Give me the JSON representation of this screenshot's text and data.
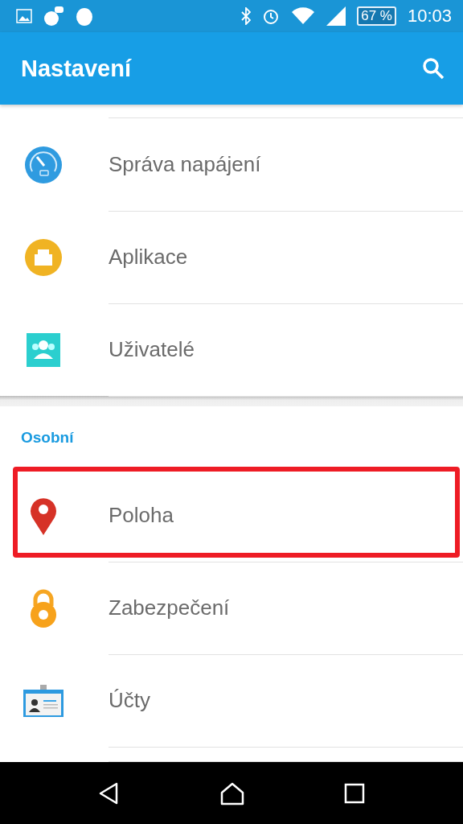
{
  "status_bar": {
    "battery": "67 %",
    "time": "10:03"
  },
  "app_bar": {
    "title": "Nastavení"
  },
  "sections": [
    {
      "items": [
        {
          "label": "Správa napájení",
          "kind": "gauge",
          "highlighted": false
        },
        {
          "label": "Aplikace",
          "kind": "apps",
          "highlighted": false
        },
        {
          "label": "Uživatelé",
          "kind": "users",
          "highlighted": false
        }
      ]
    },
    {
      "header": "Osobní",
      "items": [
        {
          "label": "Poloha",
          "kind": "pin",
          "highlighted": true
        },
        {
          "label": "Zabezpečení",
          "kind": "lock",
          "highlighted": false
        },
        {
          "label": "Účty",
          "kind": "card",
          "highlighted": false
        }
      ]
    }
  ]
}
